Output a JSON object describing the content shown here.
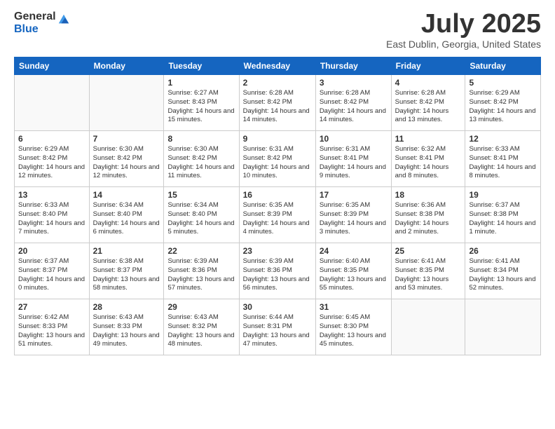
{
  "logo": {
    "general": "General",
    "blue": "Blue"
  },
  "title": "July 2025",
  "location": "East Dublin, Georgia, United States",
  "days_of_week": [
    "Sunday",
    "Monday",
    "Tuesday",
    "Wednesday",
    "Thursday",
    "Friday",
    "Saturday"
  ],
  "weeks": [
    [
      {
        "day": "",
        "sunrise": "",
        "sunset": "",
        "daylight": "",
        "empty": true
      },
      {
        "day": "",
        "sunrise": "",
        "sunset": "",
        "daylight": "",
        "empty": true
      },
      {
        "day": "1",
        "sunrise": "Sunrise: 6:27 AM",
        "sunset": "Sunset: 8:43 PM",
        "daylight": "Daylight: 14 hours and 15 minutes.",
        "empty": false
      },
      {
        "day": "2",
        "sunrise": "Sunrise: 6:28 AM",
        "sunset": "Sunset: 8:42 PM",
        "daylight": "Daylight: 14 hours and 14 minutes.",
        "empty": false
      },
      {
        "day": "3",
        "sunrise": "Sunrise: 6:28 AM",
        "sunset": "Sunset: 8:42 PM",
        "daylight": "Daylight: 14 hours and 14 minutes.",
        "empty": false
      },
      {
        "day": "4",
        "sunrise": "Sunrise: 6:28 AM",
        "sunset": "Sunset: 8:42 PM",
        "daylight": "Daylight: 14 hours and 13 minutes.",
        "empty": false
      },
      {
        "day": "5",
        "sunrise": "Sunrise: 6:29 AM",
        "sunset": "Sunset: 8:42 PM",
        "daylight": "Daylight: 14 hours and 13 minutes.",
        "empty": false
      }
    ],
    [
      {
        "day": "6",
        "sunrise": "Sunrise: 6:29 AM",
        "sunset": "Sunset: 8:42 PM",
        "daylight": "Daylight: 14 hours and 12 minutes.",
        "empty": false
      },
      {
        "day": "7",
        "sunrise": "Sunrise: 6:30 AM",
        "sunset": "Sunset: 8:42 PM",
        "daylight": "Daylight: 14 hours and 12 minutes.",
        "empty": false
      },
      {
        "day": "8",
        "sunrise": "Sunrise: 6:30 AM",
        "sunset": "Sunset: 8:42 PM",
        "daylight": "Daylight: 14 hours and 11 minutes.",
        "empty": false
      },
      {
        "day": "9",
        "sunrise": "Sunrise: 6:31 AM",
        "sunset": "Sunset: 8:42 PM",
        "daylight": "Daylight: 14 hours and 10 minutes.",
        "empty": false
      },
      {
        "day": "10",
        "sunrise": "Sunrise: 6:31 AM",
        "sunset": "Sunset: 8:41 PM",
        "daylight": "Daylight: 14 hours and 9 minutes.",
        "empty": false
      },
      {
        "day": "11",
        "sunrise": "Sunrise: 6:32 AM",
        "sunset": "Sunset: 8:41 PM",
        "daylight": "Daylight: 14 hours and 8 minutes.",
        "empty": false
      },
      {
        "day": "12",
        "sunrise": "Sunrise: 6:33 AM",
        "sunset": "Sunset: 8:41 PM",
        "daylight": "Daylight: 14 hours and 8 minutes.",
        "empty": false
      }
    ],
    [
      {
        "day": "13",
        "sunrise": "Sunrise: 6:33 AM",
        "sunset": "Sunset: 8:40 PM",
        "daylight": "Daylight: 14 hours and 7 minutes.",
        "empty": false
      },
      {
        "day": "14",
        "sunrise": "Sunrise: 6:34 AM",
        "sunset": "Sunset: 8:40 PM",
        "daylight": "Daylight: 14 hours and 6 minutes.",
        "empty": false
      },
      {
        "day": "15",
        "sunrise": "Sunrise: 6:34 AM",
        "sunset": "Sunset: 8:40 PM",
        "daylight": "Daylight: 14 hours and 5 minutes.",
        "empty": false
      },
      {
        "day": "16",
        "sunrise": "Sunrise: 6:35 AM",
        "sunset": "Sunset: 8:39 PM",
        "daylight": "Daylight: 14 hours and 4 minutes.",
        "empty": false
      },
      {
        "day": "17",
        "sunrise": "Sunrise: 6:35 AM",
        "sunset": "Sunset: 8:39 PM",
        "daylight": "Daylight: 14 hours and 3 minutes.",
        "empty": false
      },
      {
        "day": "18",
        "sunrise": "Sunrise: 6:36 AM",
        "sunset": "Sunset: 8:38 PM",
        "daylight": "Daylight: 14 hours and 2 minutes.",
        "empty": false
      },
      {
        "day": "19",
        "sunrise": "Sunrise: 6:37 AM",
        "sunset": "Sunset: 8:38 PM",
        "daylight": "Daylight: 14 hours and 1 minute.",
        "empty": false
      }
    ],
    [
      {
        "day": "20",
        "sunrise": "Sunrise: 6:37 AM",
        "sunset": "Sunset: 8:37 PM",
        "daylight": "Daylight: 14 hours and 0 minutes.",
        "empty": false
      },
      {
        "day": "21",
        "sunrise": "Sunrise: 6:38 AM",
        "sunset": "Sunset: 8:37 PM",
        "daylight": "Daylight: 13 hours and 58 minutes.",
        "empty": false
      },
      {
        "day": "22",
        "sunrise": "Sunrise: 6:39 AM",
        "sunset": "Sunset: 8:36 PM",
        "daylight": "Daylight: 13 hours and 57 minutes.",
        "empty": false
      },
      {
        "day": "23",
        "sunrise": "Sunrise: 6:39 AM",
        "sunset": "Sunset: 8:36 PM",
        "daylight": "Daylight: 13 hours and 56 minutes.",
        "empty": false
      },
      {
        "day": "24",
        "sunrise": "Sunrise: 6:40 AM",
        "sunset": "Sunset: 8:35 PM",
        "daylight": "Daylight: 13 hours and 55 minutes.",
        "empty": false
      },
      {
        "day": "25",
        "sunrise": "Sunrise: 6:41 AM",
        "sunset": "Sunset: 8:35 PM",
        "daylight": "Daylight: 13 hours and 53 minutes.",
        "empty": false
      },
      {
        "day": "26",
        "sunrise": "Sunrise: 6:41 AM",
        "sunset": "Sunset: 8:34 PM",
        "daylight": "Daylight: 13 hours and 52 minutes.",
        "empty": false
      }
    ],
    [
      {
        "day": "27",
        "sunrise": "Sunrise: 6:42 AM",
        "sunset": "Sunset: 8:33 PM",
        "daylight": "Daylight: 13 hours and 51 minutes.",
        "empty": false
      },
      {
        "day": "28",
        "sunrise": "Sunrise: 6:43 AM",
        "sunset": "Sunset: 8:33 PM",
        "daylight": "Daylight: 13 hours and 49 minutes.",
        "empty": false
      },
      {
        "day": "29",
        "sunrise": "Sunrise: 6:43 AM",
        "sunset": "Sunset: 8:32 PM",
        "daylight": "Daylight: 13 hours and 48 minutes.",
        "empty": false
      },
      {
        "day": "30",
        "sunrise": "Sunrise: 6:44 AM",
        "sunset": "Sunset: 8:31 PM",
        "daylight": "Daylight: 13 hours and 47 minutes.",
        "empty": false
      },
      {
        "day": "31",
        "sunrise": "Sunrise: 6:45 AM",
        "sunset": "Sunset: 8:30 PM",
        "daylight": "Daylight: 13 hours and 45 minutes.",
        "empty": false
      },
      {
        "day": "",
        "sunrise": "",
        "sunset": "",
        "daylight": "",
        "empty": true
      },
      {
        "day": "",
        "sunrise": "",
        "sunset": "",
        "daylight": "",
        "empty": true
      }
    ]
  ]
}
